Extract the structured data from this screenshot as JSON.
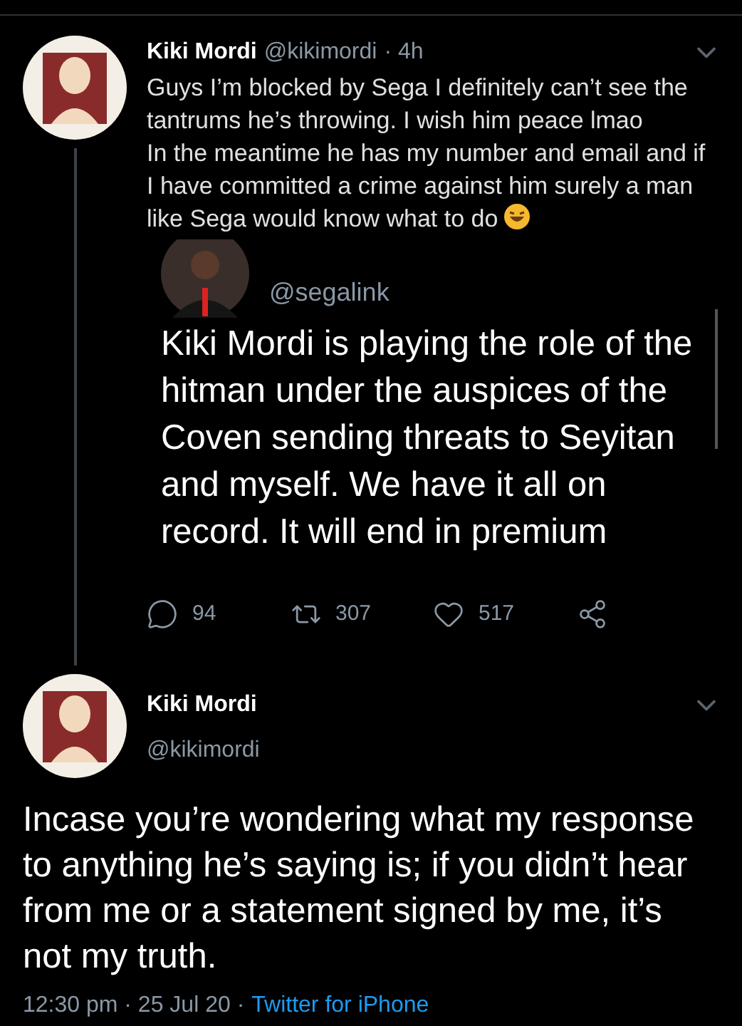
{
  "tweet": {
    "author": "Kiki Mordi",
    "handle": "@kikimordi",
    "time": "· 4h",
    "text": "Guys I’m blocked by Sega I definitely can’t see the tantrums he’s throwing. I wish him peace lmao\nIn the meantime he has my number and email and if I have committed a crime against him surely a man like Sega would know what to do"
  },
  "quoted_screenshot": {
    "handle": "@segalink",
    "text": "Kiki Mordi is playing the role of the hitman under the auspices of the Coven sending threats to Seyitan and myself. We have it all on record. It will end in premium",
    "stats": [
      {
        "kind": "reply",
        "count": "94"
      },
      {
        "kind": "retweet",
        "count": "307"
      },
      {
        "kind": "like",
        "count": "517"
      },
      {
        "kind": "share"
      }
    ]
  },
  "reply_tweet": {
    "author": "Kiki Mordi",
    "handle": "@kikimordi",
    "text": "Incase you’re wondering what my response to anything he’s saying is; if you didn’t hear from me or a statement signed by me, it’s not my truth.",
    "timestamp": "12:30 pm · 25 Jul 20 ·",
    "source": "Twitter for iPhone"
  }
}
